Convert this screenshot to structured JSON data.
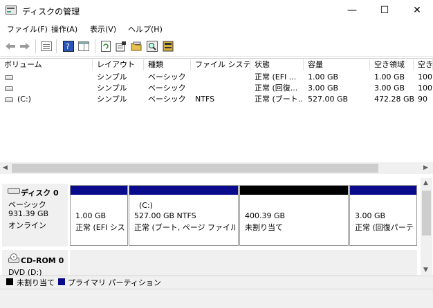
{
  "window": {
    "title": "ディスクの管理",
    "min": "—",
    "max": "☐",
    "close": "✕"
  },
  "menu": [
    "ファイル(F)",
    "操作(A)",
    "表示(V)",
    "ヘルプ(H)"
  ],
  "toolbar": {
    "back": "back-arrow",
    "forward": "forward-arrow",
    "icons": [
      "list-view",
      "help",
      "pane",
      "refresh",
      "properties",
      "open-folder",
      "search",
      "rescan"
    ]
  },
  "columns": [
    "ボリューム",
    "レイアウト",
    "種類",
    "ファイル システム",
    "状態",
    "容量",
    "空き領域",
    "空き"
  ],
  "rows": [
    {
      "volume": "",
      "layout": "シンプル",
      "type": "ベーシック",
      "fs": "",
      "status": "正常 (EFI ...",
      "capacity": "1.00 GB",
      "free": "1.00 GB",
      "pct": "100"
    },
    {
      "volume": "",
      "layout": "シンプル",
      "type": "ベーシック",
      "fs": "",
      "status": "正常 (回復...",
      "capacity": "3.00 GB",
      "free": "3.00 GB",
      "pct": "100"
    },
    {
      "volume": "(C:)",
      "layout": "シンプル",
      "type": "ベーシック",
      "fs": "NTFS",
      "status": "正常 (ブート...",
      "capacity": "527.00 GB",
      "free": "472.28 GB",
      "pct": "90"
    }
  ],
  "disk0": {
    "name": "ディスク 0",
    "kind": "ベーシック",
    "size": "931.39 GB",
    "state": "オンライン"
  },
  "partitions": [
    {
      "title": "",
      "size": "1.00 GB",
      "status": "正常 (EFI シス"
    },
    {
      "title": "(C:)",
      "size": "527.00 GB NTFS",
      "status": "正常 (ブート, ページ ファイル, クラ"
    },
    {
      "title": "",
      "size": "400.39 GB",
      "status": "未割り当て"
    },
    {
      "title": "",
      "size": "3.00 GB",
      "status": "正常 (回復パーティ"
    }
  ],
  "cdrom": {
    "name": "CD-ROM 0",
    "drive": "DVD (D:)"
  },
  "legend": {
    "unallocated": "未割り当て",
    "primary": "プライマリ パーティション"
  },
  "colors": {
    "primary": "#0a0a8c",
    "unallocated": "#000000",
    "gray": "#f0f0f0"
  }
}
